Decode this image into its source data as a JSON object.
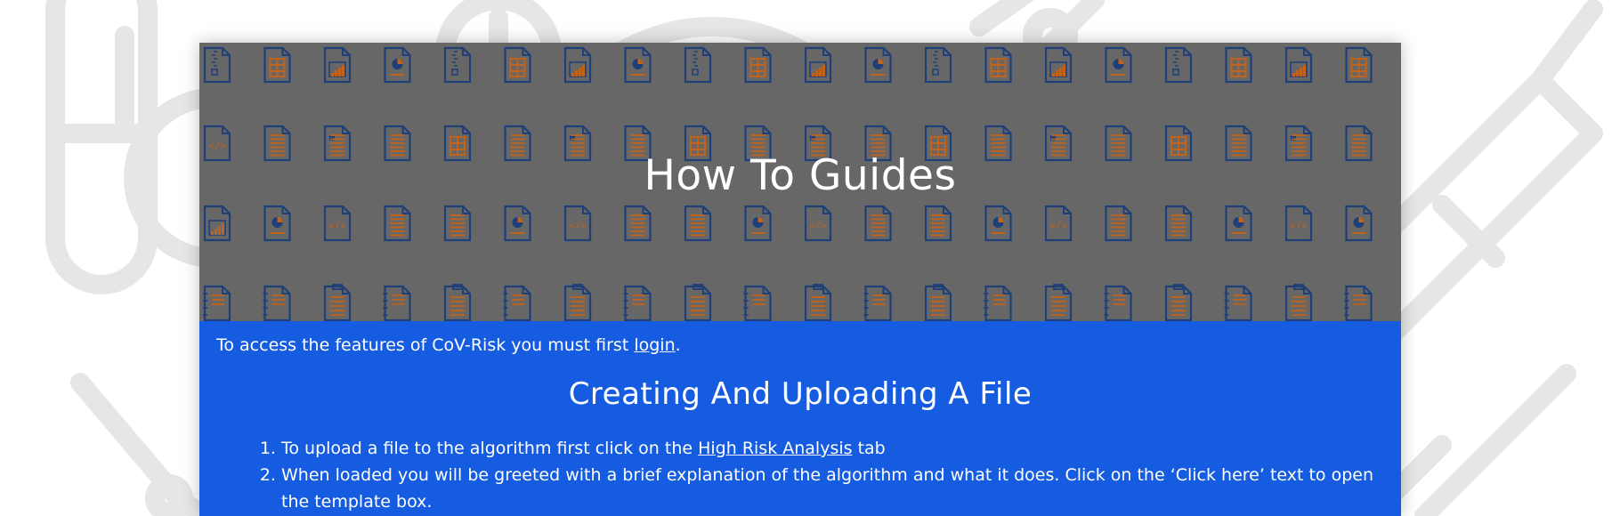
{
  "banner": {
    "title": "How To Guides"
  },
  "intro": {
    "text_before": "To access the features of CoV-Risk you must first ",
    "login_link": "login",
    "text_after": "."
  },
  "section": {
    "title": "Creating And Uploading A File"
  },
  "steps": [
    {
      "before": "To upload a file to the algorithm first click on the ",
      "link": "High Risk Analysis",
      "after": " tab"
    },
    {
      "before": "When loaded you will be greeted with a brief explanation of the algorithm and what it does. Click on the ‘Click here’ text to open the template box.",
      "link": "",
      "after": ""
    }
  ],
  "colors": {
    "banner_bg": "#676767",
    "content_bg": "#155ce0",
    "icon_outline": "#1e3f78",
    "icon_fill": "#c0631d",
    "decor": "#e6e6e6"
  },
  "icons": [
    "document-icon",
    "spreadsheet-icon",
    "chart-document-icon",
    "pie-chart-document-icon",
    "code-document-icon",
    "zip-document-icon",
    "clipboard-icon",
    "notebook-icon",
    "pill-icon",
    "syringe-icon",
    "stopwatch-icon",
    "thermometer-icon"
  ]
}
